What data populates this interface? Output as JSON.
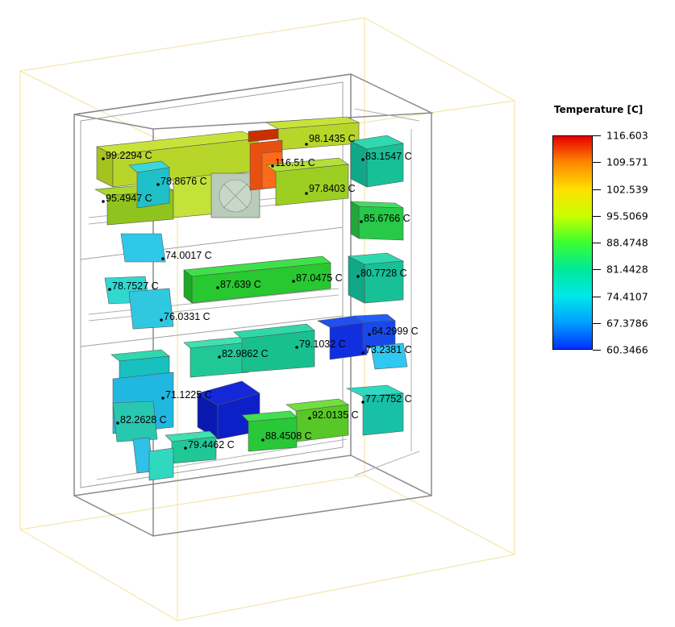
{
  "legend": {
    "title": "Temperature [C]",
    "ticks": [
      "116.603",
      "109.571",
      "102.539",
      "95.5069",
      "88.4748",
      "81.4428",
      "74.4107",
      "67.3786",
      "60.3466"
    ],
    "gradient": [
      "#e60000",
      "#ff8800",
      "#ffe000",
      "#c8ff00",
      "#3cff30",
      "#00e898",
      "#00e8e8",
      "#00a0ff",
      "#0030ff"
    ]
  },
  "labels": {
    "l1": "99.2294 C",
    "l2": "98.1435 C",
    "l3": "83.1547 C",
    "l4": "78.8676 C",
    "l5": "116.51 C",
    "l6": "95.4947 C",
    "l7": "97.8403 C",
    "l8": "85.6766 C",
    "l9": "74.0017 C",
    "l10": "87.639 C",
    "l11": "87.0475 C",
    "l12": "80.7728 C",
    "l13": "78.7527 C",
    "l14": "76.0331 C",
    "l15": "64.2999 C",
    "l16": "82.9862 C",
    "l17": "79.1032 C",
    "l18": "73.2381 C",
    "l19": "71.1225 C",
    "l20": "77.7752 C",
    "l21": "82.2628 C",
    "l22": "92.0135 C",
    "l23": "79.4462 C",
    "l24": "88.4508 C"
  },
  "colors": {
    "frame": "#808080",
    "bounding_box": "#f5e6a0"
  }
}
